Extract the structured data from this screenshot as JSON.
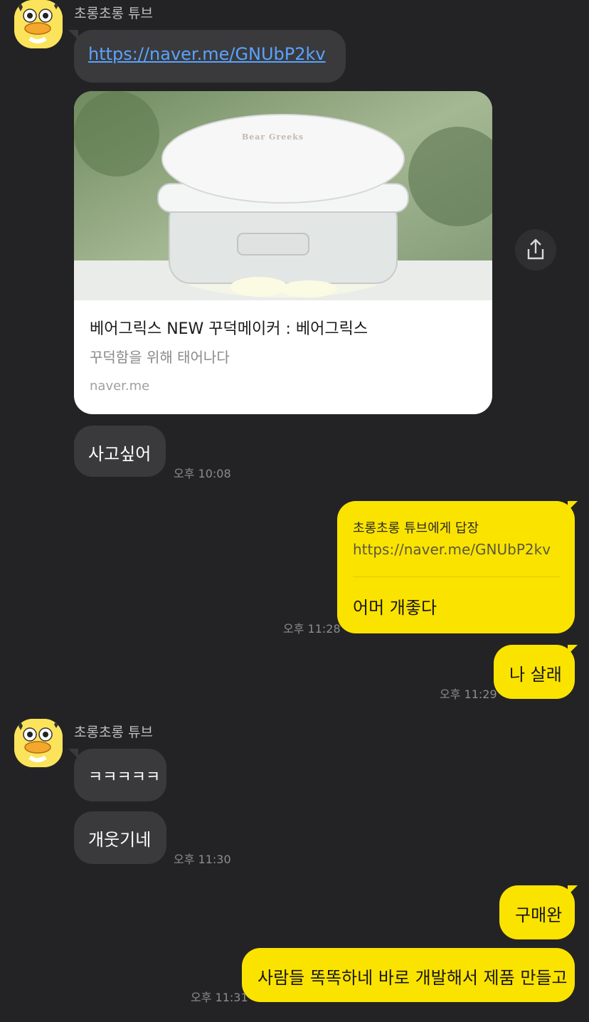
{
  "chat": {
    "messages": [
      {
        "sender": "초롱초롱 튜브",
        "link": "https://naver.me/GNUbP2kv"
      },
      {
        "card": {
          "title": "베어그릭스 NEW 꾸덕메이커 : 베어그릭스",
          "desc": "꾸덕함을 위해 태어나다",
          "domain": "naver.me",
          "image_brand": "Bear Greeks"
        }
      },
      {
        "text": "사고싶어",
        "time": "오후 10:08"
      },
      {
        "reply_to": "초롱초롱 튜브에게 답장",
        "quoted": "https://naver.me/GNUbP2kv",
        "text": "어머 개좋다",
        "time": "오후 11:28"
      },
      {
        "text": "나 살래",
        "time": "오후 11:29"
      },
      {
        "sender": "초롱초롱 튜브",
        "text": "ㅋㅋㅋㅋㅋ"
      },
      {
        "text": "개웃기네",
        "time": "오후 11:30"
      },
      {
        "text": "구매완"
      },
      {
        "text": "사람들 똑똑하네 바로 개발해서 제품 만들고",
        "time": "오후 11:31"
      }
    ]
  },
  "colors": {
    "background": "#232325",
    "incoming_bubble": "#3a3a3c",
    "outgoing_bubble": "#fbe300",
    "link": "#5aa3ff"
  }
}
